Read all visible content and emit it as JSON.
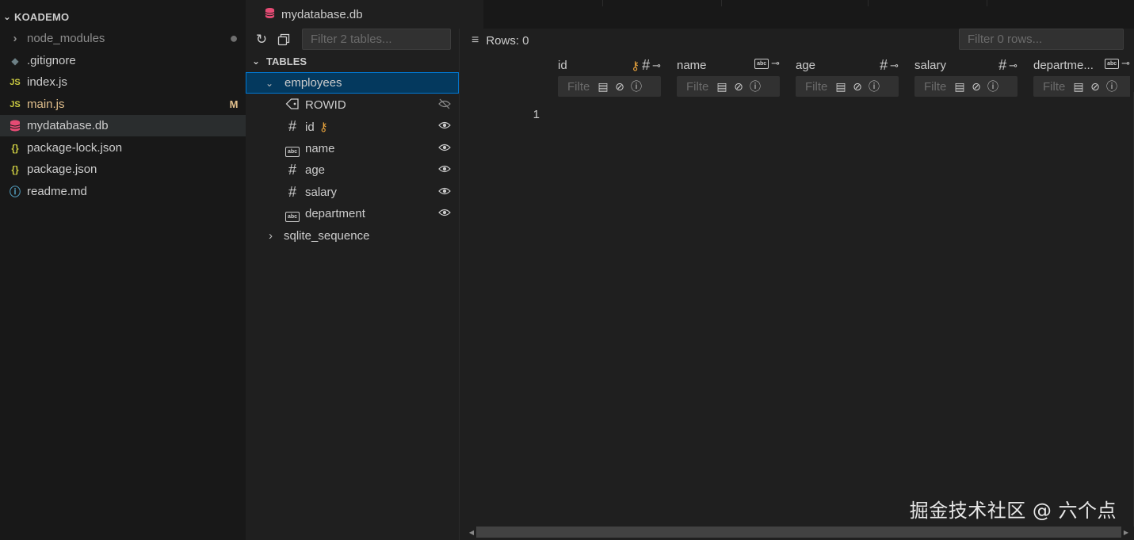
{
  "explorer": {
    "folder_name": "KOADEMO",
    "items": [
      {
        "name": "node_modules",
        "icon": "chevron-right-icon",
        "glyph": "›",
        "badge": "●",
        "style": "muted"
      },
      {
        "name": ".gitignore",
        "icon": "git-icon",
        "glyph": "◆",
        "badge": "",
        "style": "normal"
      },
      {
        "name": "index.js",
        "icon": "js-icon",
        "glyph": "JS",
        "badge": "",
        "style": "normal"
      },
      {
        "name": "main.js",
        "icon": "js-icon",
        "glyph": "JS",
        "badge": "M",
        "style": "modified"
      },
      {
        "name": "mydatabase.db",
        "icon": "database-icon",
        "glyph": "",
        "badge": "",
        "style": "selected"
      },
      {
        "name": "package-lock.json",
        "icon": "json-icon",
        "glyph": "{}",
        "badge": "",
        "style": "normal"
      },
      {
        "name": "package.json",
        "icon": "json-icon",
        "glyph": "{}",
        "badge": "",
        "style": "normal"
      },
      {
        "name": "readme.md",
        "icon": "info-icon",
        "glyph": "ⓘ",
        "badge": "",
        "style": "normal"
      }
    ]
  },
  "tab": {
    "title": "mydatabase.db"
  },
  "tables_panel": {
    "filter_placeholder": "Filter 2 tables...",
    "section_title": "TABLES",
    "tables": [
      {
        "name": "employees",
        "expanded": true,
        "columns": [
          {
            "name": "ROWID",
            "type_icon": "tag-icon",
            "key": false,
            "visible": false
          },
          {
            "name": "id",
            "type_icon": "hash-icon",
            "key": true,
            "visible": true
          },
          {
            "name": "name",
            "type_icon": "text-type-icon",
            "key": false,
            "visible": true
          },
          {
            "name": "age",
            "type_icon": "hash-icon",
            "key": false,
            "visible": true
          },
          {
            "name": "salary",
            "type_icon": "hash-icon",
            "key": false,
            "visible": true
          },
          {
            "name": "department",
            "type_icon": "text-type-icon",
            "key": false,
            "visible": true
          }
        ]
      },
      {
        "name": "sqlite_sequence",
        "expanded": false
      }
    ]
  },
  "grid": {
    "rows_label": "Rows: 0",
    "row_filter_placeholder": "Filter 0 rows...",
    "column_filter_placeholder": "Filte",
    "columns": [
      {
        "name": "id",
        "type_icon": "hash-icon",
        "key": true
      },
      {
        "name": "name",
        "type_icon": "text-type-icon",
        "key": false
      },
      {
        "name": "age",
        "type_icon": "hash-icon",
        "key": false
      },
      {
        "name": "salary",
        "type_icon": "hash-icon",
        "key": false
      },
      {
        "name": "departme...",
        "type_icon": "text-type-icon",
        "key": false
      }
    ],
    "row_numbers": [
      "1"
    ]
  },
  "watermark": "掘金技术社区 @ 六个点",
  "colors": {
    "accent": "#0078d4",
    "selection": "#04395e",
    "key": "#e8a33d",
    "db_icon": "#e54b74",
    "js_icon": "#cbcb41",
    "modified": "#e2c08d"
  }
}
